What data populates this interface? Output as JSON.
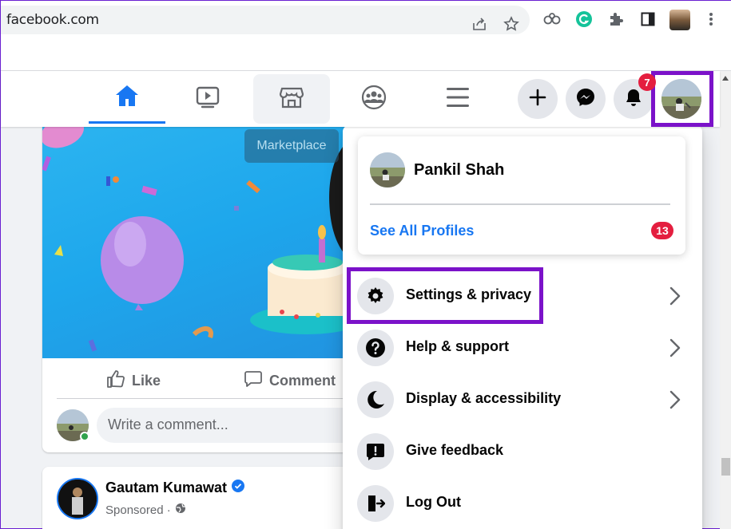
{
  "browser": {
    "url": "facebook.com",
    "icons": [
      "share-icon",
      "star-icon",
      "extension-icon",
      "grammarly-icon",
      "puzzle-icon",
      "sidepanel-icon",
      "profile-avatar-icon",
      "kebab-menu-icon"
    ]
  },
  "nav": {
    "tabs": [
      "home-icon",
      "watch-icon",
      "marketplace-icon",
      "groups-icon",
      "menu-icon"
    ],
    "buttons": [
      "create-plus-icon",
      "messenger-icon",
      "notifications-bell-icon"
    ],
    "notification_count": "7",
    "tooltip": "Marketplace"
  },
  "feed": {
    "like_label": "Like",
    "comment_label": "Comment",
    "comment_placeholder": "Write a comment...",
    "post_author": "Gautam Kumawat",
    "post_meta": "Sponsored ·"
  },
  "menu": {
    "profile_name": "Pankil Shah",
    "see_all_profiles": "See All Profiles",
    "profiles_badge": "13",
    "items": [
      {
        "label": "Settings & privacy",
        "icon": "gear-icon",
        "has_chevron": true
      },
      {
        "label": "Help & support",
        "icon": "question-icon",
        "has_chevron": true
      },
      {
        "label": "Display & accessibility",
        "icon": "moon-icon",
        "has_chevron": true
      },
      {
        "label": "Give feedback",
        "icon": "feedback-icon",
        "has_chevron": false
      },
      {
        "label": "Log Out",
        "icon": "logout-icon",
        "has_chevron": false
      }
    ]
  },
  "colors": {
    "highlight": "#7b12c9",
    "fb_blue": "#1877f2",
    "badge_red": "#e41e3f"
  }
}
